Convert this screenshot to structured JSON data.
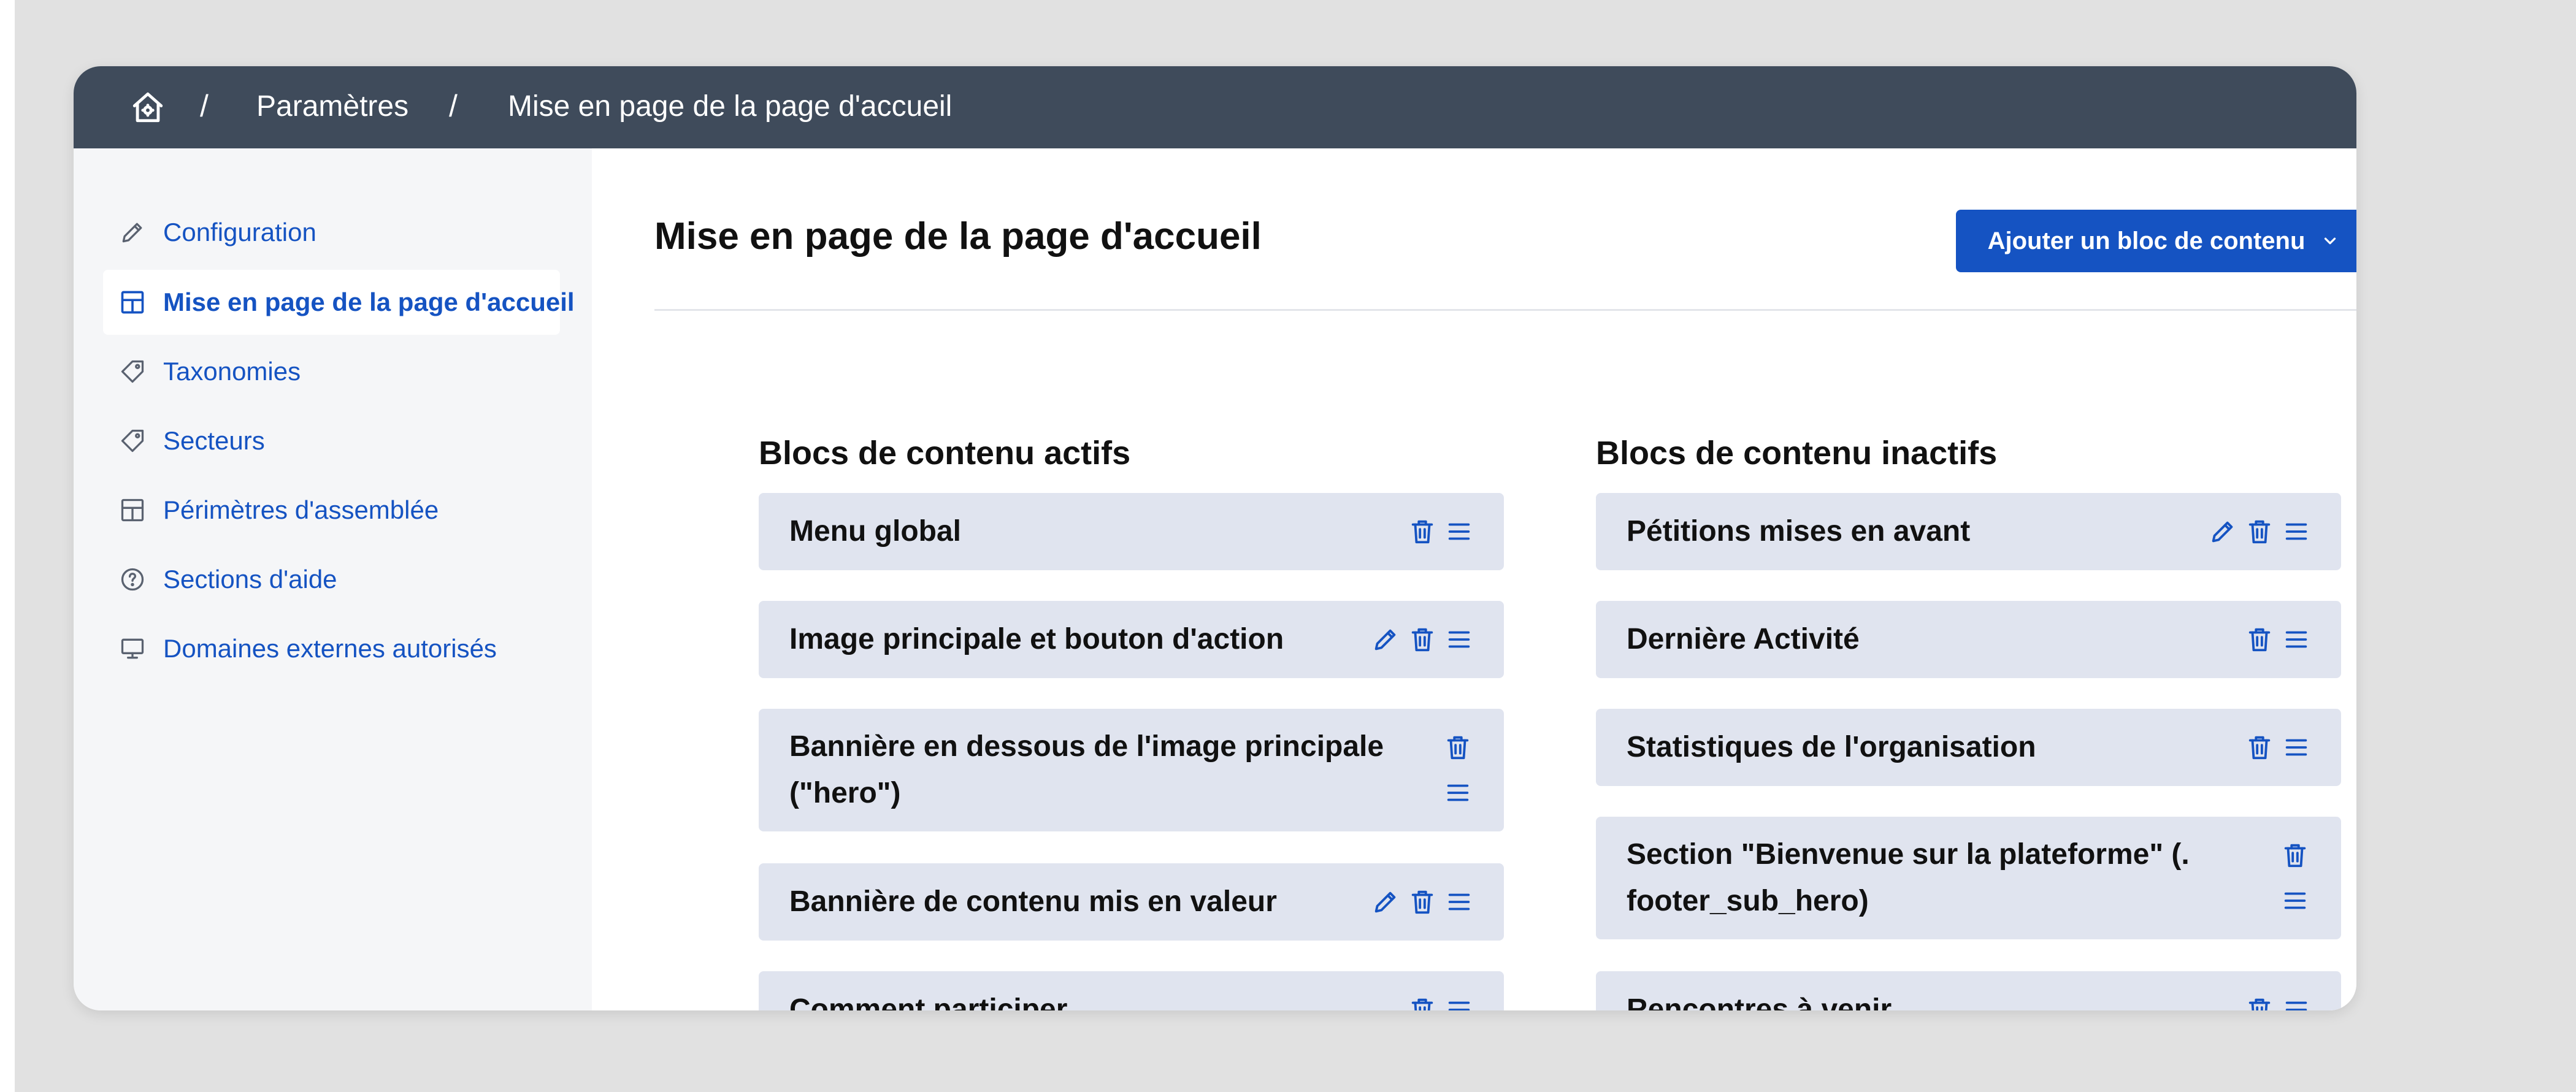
{
  "breadcrumb": {
    "home_icon": "home-icon",
    "items": [
      "Paramètres",
      "Mise en page de la page d'accueil"
    ],
    "separator": "/"
  },
  "sidebar": {
    "items": [
      {
        "label": "Configuration",
        "icon": "pencil-icon",
        "active": false
      },
      {
        "label": "Mise en page de la page d'accueil",
        "icon": "layout-icon",
        "active": true
      },
      {
        "label": "Taxonomies",
        "icon": "tag-icon",
        "active": false
      },
      {
        "label": "Secteurs",
        "icon": "tag-icon",
        "active": false
      },
      {
        "label": "Périmètres d'assemblée",
        "icon": "layout-icon",
        "active": false
      },
      {
        "label": "Sections d'aide",
        "icon": "help-circle-icon",
        "active": false
      },
      {
        "label": "Domaines externes autorisés",
        "icon": "monitor-icon",
        "active": false
      }
    ]
  },
  "main": {
    "title": "Mise en page de la page d'accueil",
    "add_button_label": "Ajouter un bloc de contenu",
    "active_column": {
      "title": "Blocs de contenu actifs",
      "blocks": [
        {
          "label": "Menu global",
          "editable": false
        },
        {
          "label": "Image principale et bouton d'action",
          "editable": true
        },
        {
          "label": "Bannière en dessous de l'image principale (\"hero\")",
          "editable": false
        },
        {
          "label": "Bannière de contenu mis en valeur",
          "editable": true
        },
        {
          "label": "Comment participer",
          "editable": false
        }
      ]
    },
    "inactive_column": {
      "title": "Blocs de contenu inactifs",
      "blocks": [
        {
          "label": "Pétitions mises en avant",
          "editable": true
        },
        {
          "label": "Dernière Activité",
          "editable": false
        },
        {
          "label": "Statistiques de l'organisation",
          "editable": false
        },
        {
          "label": "Section \"Bienvenue sur la plateforme\" (. footer_sub_hero)",
          "editable": false
        },
        {
          "label": "Rencontres à venir",
          "editable": false
        }
      ]
    }
  },
  "colors": {
    "topbar": "#3f4b5b",
    "accent": "#1553c2",
    "block_bg": "#e0e4ef",
    "sidebar_bg": "#f5f6f8"
  }
}
